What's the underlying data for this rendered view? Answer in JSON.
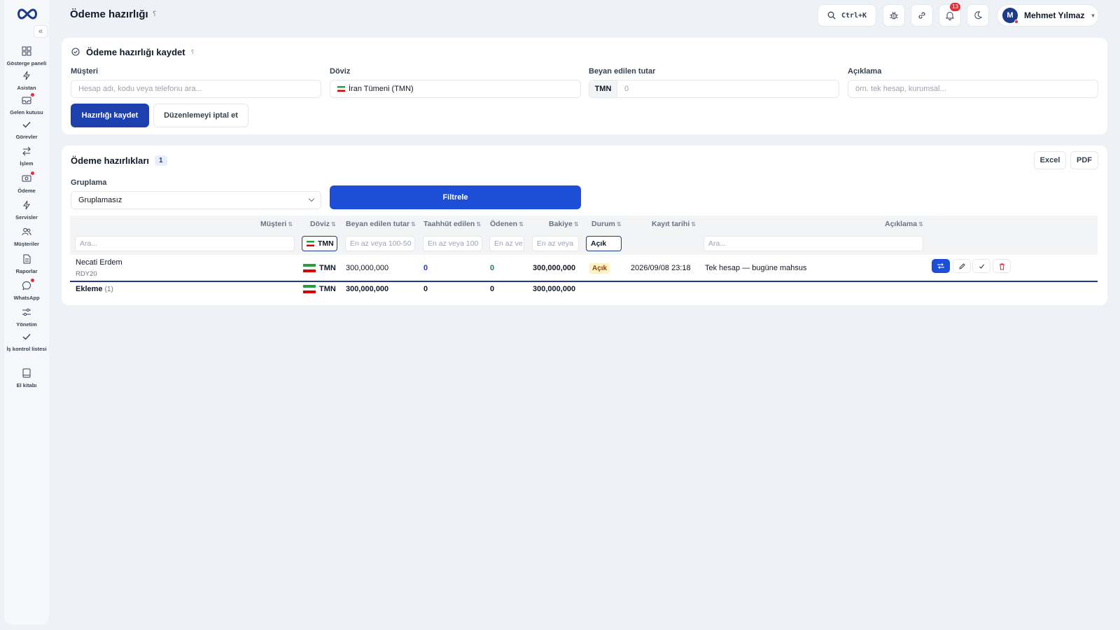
{
  "header": {
    "title": "Ödeme hazırlığı",
    "help_glyph": "؟",
    "search_shortcut": "Ctrl+K",
    "notifications_count": "13",
    "user_initial": "M",
    "user_name": "Mehmet Yılmaz"
  },
  "sidebar": {
    "collapse_glyph": "«",
    "items": [
      {
        "label": "Gösterge paneli",
        "icon": "dashboard-icon"
      },
      {
        "label": "Asistan",
        "icon": "bolt-icon"
      },
      {
        "label": "Gelen kutusu",
        "icon": "inbox-icon"
      },
      {
        "label": "Görevler",
        "icon": "check-icon"
      },
      {
        "label": "İşlem",
        "icon": "swap-icon"
      },
      {
        "label": "Ödeme",
        "icon": "cash-icon"
      },
      {
        "label": "Servisler",
        "icon": "bolt-icon"
      },
      {
        "label": "Müşteriler",
        "icon": "users-icon"
      },
      {
        "label": "Raporlar",
        "icon": "report-icon"
      },
      {
        "label": "WhatsApp",
        "icon": "chat-icon"
      },
      {
        "label": "Yönetim",
        "icon": "sliders-icon"
      },
      {
        "label": "İş kontrol listesi",
        "icon": "check-icon"
      },
      {
        "label": "El kitabı",
        "icon": "book-icon"
      }
    ]
  },
  "form": {
    "title": "Ödeme hazırlığı kaydet",
    "help_glyph": "؟",
    "customer_label": "Müşteri",
    "customer_placeholder": "Hesap adı, kodu veya telefonu ara...",
    "currency_label": "Döviz",
    "currency_value": "İran Tümeni (TMN)",
    "amount_label": "Beyan edilen tutar",
    "amount_prefix": "TMN",
    "amount_placeholder": "0",
    "note_label": "Açıklama",
    "note_placeholder": "örn. tek hesap, kurumsal...",
    "save_label": "Hazırlığı kaydet",
    "cancel_label": "Düzenlemeyi iptal et"
  },
  "list": {
    "title": "Ödeme hazırlıkları",
    "count": "1",
    "excel_label": "Excel",
    "pdf_label": "PDF",
    "grouping_label": "Gruplama",
    "grouping_value": "Gruplamasız",
    "filter_label": "Filtrele",
    "columns": [
      "Müşteri",
      "Döviz",
      "Beyan edilen tutar",
      "Taahhüt edilen",
      "Ödenen",
      "Bakiye",
      "Durum",
      "Kayıt tarihi",
      "Açıklama"
    ],
    "sort_glyph": "⇅",
    "filters": {
      "customer": "Ara...",
      "currency": "TMN",
      "declared": "En az veya 100-50",
      "committed": "En az veya 100",
      "paid": "En az ve",
      "balance": "En az veya",
      "status": "Açık",
      "note": "Ara..."
    },
    "rows": [
      {
        "customer": "Necati Erdem",
        "code": "RDY20",
        "currency": "TMN",
        "declared": "300,000,000",
        "committed": "0",
        "paid": "0",
        "balance": "300,000,000",
        "status": "Açık",
        "date": "2026/09/08 23:18",
        "note": "Tek hesap — bugüne mahsus"
      }
    ],
    "total": {
      "label": "Ekleme",
      "count": "(1)",
      "currency": "TMN",
      "declared": "300,000,000",
      "committed": "0",
      "paid": "0",
      "balance": "300,000,000"
    }
  },
  "colors": {
    "primary": "#1e40af",
    "filter_button": "#1d4ed8",
    "status_bg": "#fef3c7",
    "danger": "#dc2626"
  }
}
